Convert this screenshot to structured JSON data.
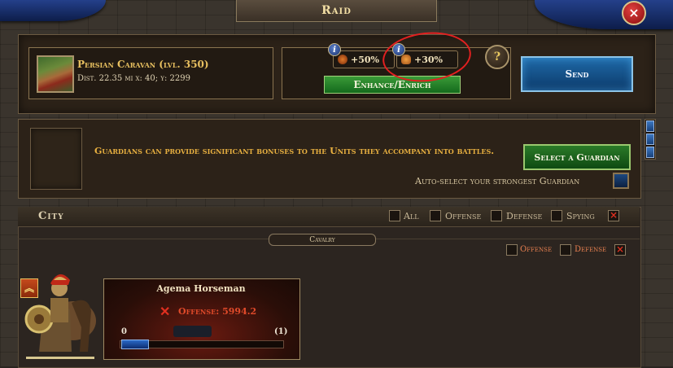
{
  "window": {
    "title": "Raid",
    "close_label": "×"
  },
  "target": {
    "name": "Persian Caravan (lvl. 350)",
    "info": "Dist. 22.35 mi  x: 40; y: 2299"
  },
  "bonuses": {
    "info_label": "i",
    "items": [
      {
        "value": "+50%",
        "icon": "helmet-icon"
      },
      {
        "value": "+30%",
        "icon": "hand-icon"
      }
    ],
    "enhance_label": "Enhance/Enrich",
    "help_label": "?"
  },
  "send_label": "Send",
  "guardian": {
    "description": "Guardians can provide significant bonuses to the Units they accompany into battles.",
    "select_label": "Select a Guardian",
    "autoselect_label": "Auto-select your strongest Guardian"
  },
  "city": {
    "title": "City",
    "filters": {
      "all": "All",
      "offense": "Offense",
      "defense": "Defense",
      "spying": "Spying"
    },
    "category_tab": "Cavalry",
    "sub_filters": {
      "offense": "Offense",
      "defense": "Defense"
    }
  },
  "unit": {
    "rank_label": "︽",
    "name": "Agema Horseman",
    "offense": "Offense: 5994.2",
    "qty_min": "0",
    "qty_max": "(1)"
  },
  "colors": {
    "accent_gold": "#e8c060",
    "send_blue": "#1f6aa8",
    "green_button": "#2a7a28",
    "offense_red": "#e04a2a",
    "annotation_red": "#e22020"
  }
}
